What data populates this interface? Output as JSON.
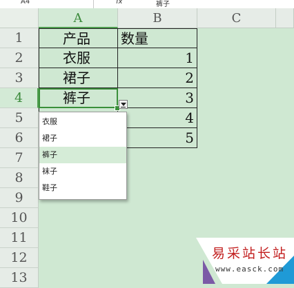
{
  "formula_bar": {
    "name_box": "A4",
    "fx_label": "fx",
    "value": "裤子"
  },
  "columns": [
    "A",
    "B",
    "C"
  ],
  "rows": [
    "1",
    "2",
    "3",
    "4",
    "5",
    "6",
    "7",
    "8",
    "9",
    "10",
    "11",
    "12",
    "13"
  ],
  "cells": {
    "a1": "产品",
    "b1": "数量",
    "a2": "衣服",
    "b2": "1",
    "a3": "裙子",
    "b3": "2",
    "a4": "裤子",
    "b4": "3",
    "b5": "4",
    "b6": "5"
  },
  "dropdown": {
    "items": [
      "衣服",
      "裙子",
      "裤子",
      "袜子",
      "鞋子"
    ],
    "selected": "裤子"
  },
  "watermark": {
    "text": "易采站长站",
    "url": "www.easck.com"
  },
  "colors": {
    "sheet_background": "#cfe8d2",
    "active_accent": "#3a8f3a",
    "watermark_red": "#c21f1f"
  }
}
